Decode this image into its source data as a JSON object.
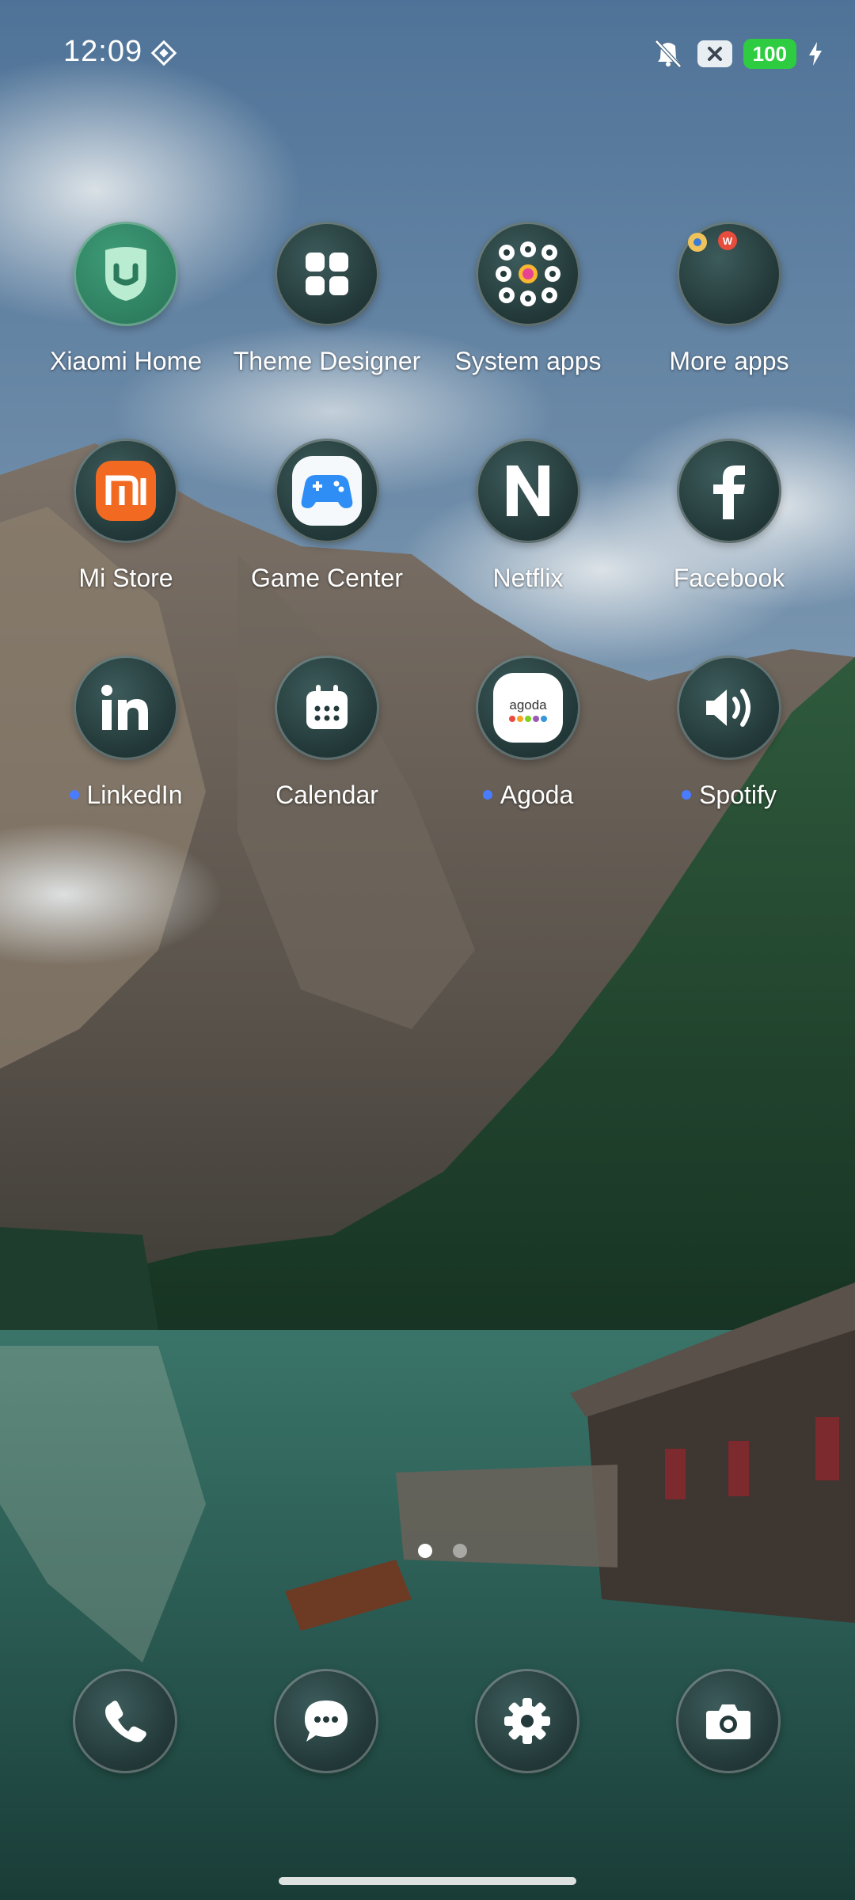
{
  "status_bar": {
    "time": "12:09",
    "battery_level": "100",
    "icons": [
      "diamond-icon",
      "mute-icon",
      "x-icon",
      "battery-icon",
      "charging-icon"
    ]
  },
  "apps": {
    "row1": [
      {
        "label": "Xiaomi Home",
        "icon": "xiaomi-home-icon"
      },
      {
        "label": "Theme Designer",
        "icon": "theme-designer-icon"
      },
      {
        "label": "System apps",
        "icon": "system-apps-folder-icon"
      },
      {
        "label": "More apps",
        "icon": "more-apps-folder-icon"
      }
    ],
    "row2": [
      {
        "label": "Mi Store",
        "icon": "mi-store-icon"
      },
      {
        "label": "Game Center",
        "icon": "game-center-icon"
      },
      {
        "label": "Netflix",
        "icon": "netflix-icon"
      },
      {
        "label": "Facebook",
        "icon": "facebook-icon"
      }
    ],
    "row3": [
      {
        "label": "LinkedIn",
        "icon": "linkedin-icon",
        "new": true
      },
      {
        "label": "Calendar",
        "icon": "calendar-icon"
      },
      {
        "label": "Agoda",
        "icon": "agoda-icon",
        "new": true,
        "logo_text": "agoda"
      },
      {
        "label": "Spotify",
        "icon": "spotify-icon",
        "new": true
      }
    ]
  },
  "dock": [
    "phone-icon",
    "messages-icon",
    "settings-icon",
    "camera-icon"
  ],
  "pager": {
    "current": 1,
    "total": 2
  },
  "colors": {
    "icon_bg": "#243a3a",
    "battery": "#2ecc40",
    "new_dot": "#4a7cff"
  }
}
